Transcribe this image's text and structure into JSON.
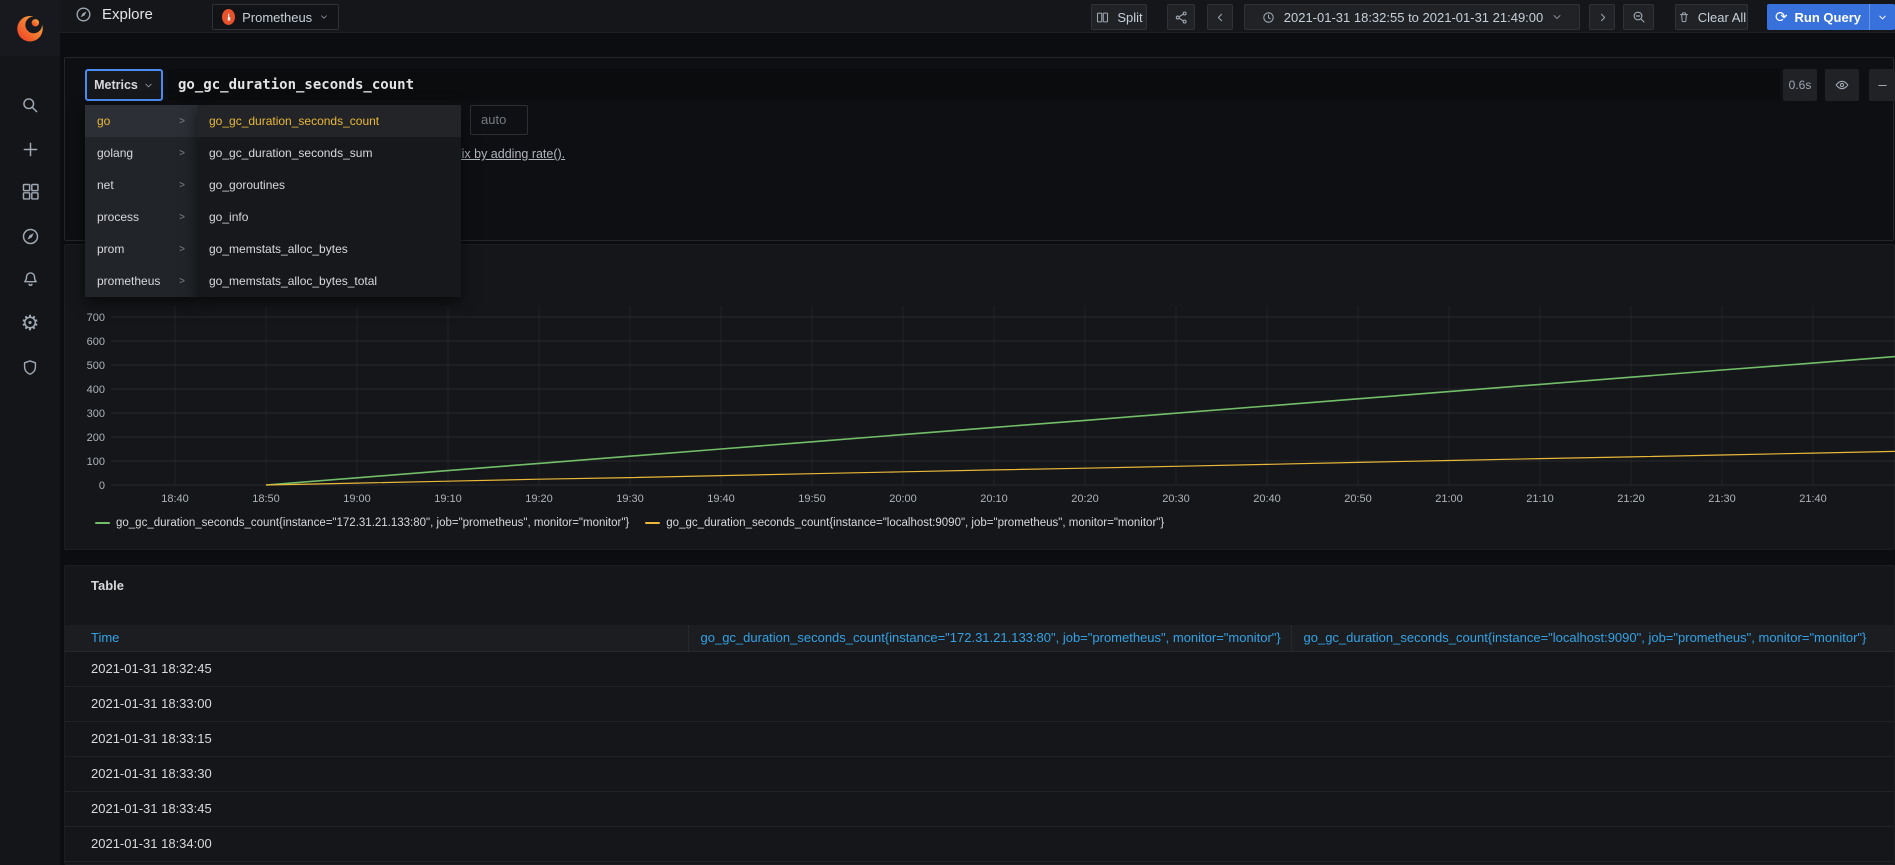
{
  "topnav": {
    "explore_label": "Explore",
    "datasource_name": "Prometheus",
    "split_label": "Split",
    "time_range": "2021-01-31 18:32:55 to 2021-01-31 21:49:00",
    "clear_all_label": "Clear All",
    "run_query_label": "Run Query"
  },
  "query_row": {
    "mode_label": "Metrics",
    "expression": "go_gc_duration_seconds_count",
    "elapsed": "0.6s",
    "step_value": "auto",
    "hint_link": "Fix by adding rate()."
  },
  "metric_dropdown": {
    "groups": [
      "go",
      "golang",
      "net",
      "process",
      "prom",
      "prometheus"
    ],
    "selected_group_index": 0,
    "metrics": [
      "go_gc_duration_seconds_count",
      "go_gc_duration_seconds_sum",
      "go_goroutines",
      "go_info",
      "go_memstats_alloc_bytes",
      "go_memstats_alloc_bytes_total"
    ],
    "selected_metric_index": 0
  },
  "chart_data": {
    "type": "line",
    "title": "",
    "xlabel": "",
    "ylabel": "",
    "x_range": [
      "18:32:55",
      "21:49:00"
    ],
    "ylim": [
      0,
      700
    ],
    "y_ticks": [
      0,
      100,
      200,
      300,
      400,
      500,
      600,
      700
    ],
    "x_ticks": [
      "18:40",
      "18:50",
      "19:00",
      "19:10",
      "19:20",
      "19:30",
      "19:40",
      "19:50",
      "20:00",
      "20:10",
      "20:20",
      "20:30",
      "20:40",
      "20:50",
      "21:00",
      "21:10",
      "21:20",
      "21:30",
      "21:40"
    ],
    "grid": true,
    "legend_position": "bottom",
    "series": [
      {
        "name": "go_gc_duration_seconds_count{instance=\"172.31.21.133:80\", job=\"prometheus\", monitor=\"monitor\"}",
        "color": "#73BF69",
        "points": [
          [
            "18:50",
            0
          ],
          [
            "19:00",
            30
          ],
          [
            "19:10",
            60
          ],
          [
            "19:20",
            90
          ],
          [
            "19:30",
            120
          ],
          [
            "19:40",
            150
          ],
          [
            "19:50",
            180
          ],
          [
            "20:00",
            210
          ],
          [
            "20:10",
            240
          ],
          [
            "20:20",
            269
          ],
          [
            "20:30",
            299
          ],
          [
            "20:40",
            329
          ],
          [
            "20:50",
            359
          ],
          [
            "21:00",
            389
          ],
          [
            "21:10",
            419
          ],
          [
            "21:20",
            449
          ],
          [
            "21:30",
            479
          ],
          [
            "21:40",
            508
          ],
          [
            "21:49",
            535
          ]
        ]
      },
      {
        "name": "go_gc_duration_seconds_count{instance=\"localhost:9090\", job=\"prometheus\", monitor=\"monitor\"}",
        "color": "#EAB839",
        "points": [
          [
            "18:50",
            0
          ],
          [
            "19:00",
            8
          ],
          [
            "19:10",
            16
          ],
          [
            "19:20",
            24
          ],
          [
            "19:30",
            31
          ],
          [
            "19:40",
            39
          ],
          [
            "19:50",
            47
          ],
          [
            "20:00",
            55
          ],
          [
            "20:10",
            63
          ],
          [
            "20:20",
            70
          ],
          [
            "20:30",
            78
          ],
          [
            "20:40",
            86
          ],
          [
            "20:50",
            94
          ],
          [
            "21:00",
            102
          ],
          [
            "21:10",
            110
          ],
          [
            "21:20",
            117
          ],
          [
            "21:30",
            125
          ],
          [
            "21:40",
            133
          ],
          [
            "21:49",
            140
          ]
        ]
      }
    ]
  },
  "table": {
    "title": "Table",
    "columns": [
      "Time",
      "go_gc_duration_seconds_count{instance=\"172.31.21.133:80\", job=\"prometheus\", monitor=\"monitor\"}",
      "go_gc_duration_seconds_count{instance=\"localhost:9090\", job=\"prometheus\", monitor=\"monitor\"}"
    ],
    "rows": [
      [
        "2021-01-31 18:32:45",
        "",
        ""
      ],
      [
        "2021-01-31 18:33:00",
        "",
        ""
      ],
      [
        "2021-01-31 18:33:15",
        "",
        ""
      ],
      [
        "2021-01-31 18:33:30",
        "",
        ""
      ],
      [
        "2021-01-31 18:33:45",
        "",
        ""
      ],
      [
        "2021-01-31 18:34:00",
        "",
        ""
      ]
    ]
  },
  "colors": {
    "page_bg": "#0B0C0E",
    "panel_bg": "#141619",
    "accent_blue": "#3871DC",
    "focus_blue": "#5794F2",
    "link_blue": "#33A2E5",
    "series_green": "#73BF69",
    "series_yellow": "#EAB839",
    "datasource_red": "#E6522C"
  }
}
